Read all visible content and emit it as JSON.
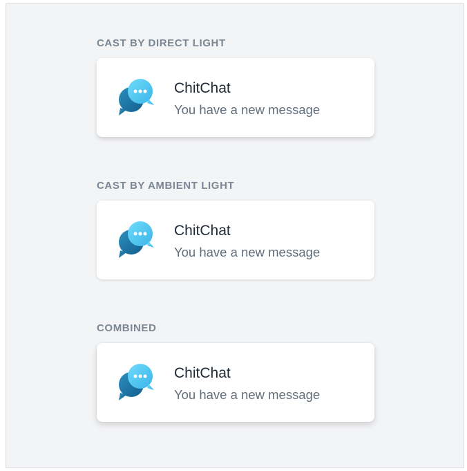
{
  "colors": {
    "panel_background": "#f3f4f6",
    "card_background": "#ffffff",
    "section_title": "#7b8794",
    "app_name": "#1f2933",
    "message_text": "#616e7c",
    "icon_light": "#5bd2f5",
    "icon_dark": "#1a6f9f"
  },
  "sections": [
    {
      "title": "CAST BY DIRECT LIGHT",
      "notification": {
        "icon": "chat-bubbles-icon",
        "app_name": "ChitChat",
        "message": "You have a new message"
      }
    },
    {
      "title": "CAST BY AMBIENT LIGHT",
      "notification": {
        "icon": "chat-bubbles-icon",
        "app_name": "ChitChat",
        "message": "You have a new message"
      }
    },
    {
      "title": "COMBINED",
      "notification": {
        "icon": "chat-bubbles-icon",
        "app_name": "ChitChat",
        "message": "You have a new message"
      }
    }
  ]
}
